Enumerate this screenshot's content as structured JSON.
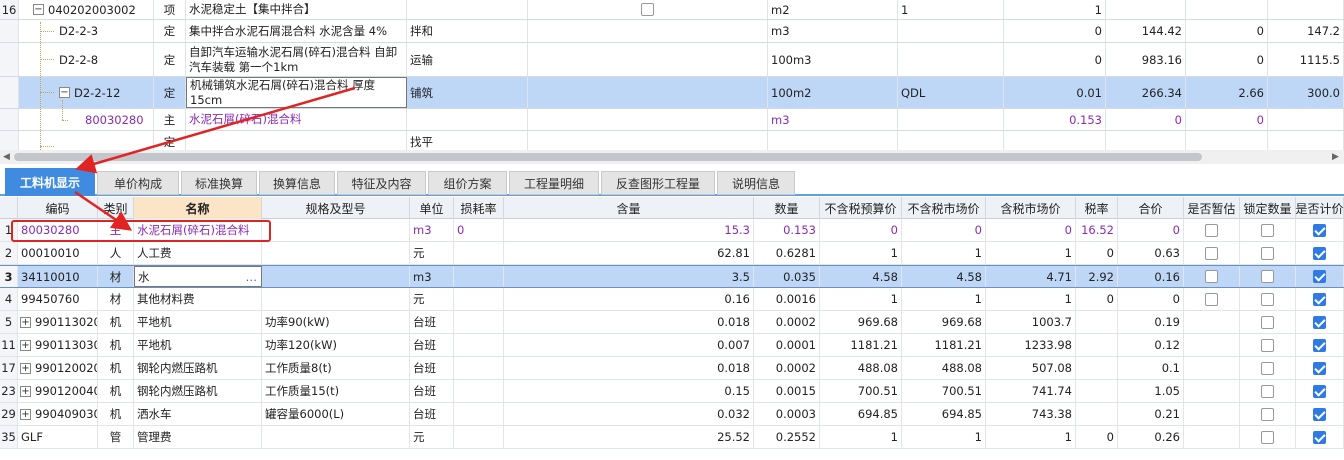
{
  "upper_rows": [
    {
      "rownum": "16",
      "code": "040202003002",
      "type": "项",
      "name": "水泥稳定土【集中拌合】",
      "spec": "",
      "unit": "m2",
      "c9": "1",
      "c10": "1",
      "c11": "",
      "c12": "",
      "c13": "",
      "c14": "",
      "expand": "−",
      "checkbox": true,
      "level": 0
    },
    {
      "rownum": "",
      "code": "D2-2-3",
      "type": "定",
      "name": "集中拌合水泥石屑混合料 水泥含量 4%",
      "spec": "拌和",
      "unit": "m3",
      "c9": "",
      "c10": "0",
      "c11": "144.42",
      "c12": "0",
      "c13": "147.2",
      "c14": "",
      "level": 1
    },
    {
      "rownum": "",
      "code": "D2-2-8",
      "type": "定",
      "name": "自卸汽车运输水泥石屑(碎石)混合料 自卸汽车装载 第一个1km",
      "spec": "运输",
      "unit": "100m3",
      "c9": "",
      "c10": "0",
      "c11": "983.16",
      "c12": "0",
      "c13": "1115.5",
      "c14": "",
      "level": 1
    },
    {
      "rownum": "",
      "code": "D2-2-12",
      "type": "定",
      "name": "机械铺筑水泥石屑(碎石)混合料 厚度 15cm",
      "spec": "铺筑",
      "unit": "100m2",
      "c9": "QDL",
      "c10": "0.01",
      "c11": "266.34",
      "c12": "2.66",
      "c13": "300.0",
      "c14": "",
      "expand": "−",
      "level": 1,
      "selected": true
    },
    {
      "rownum": "",
      "code": "80030280",
      "type": "主",
      "name": "水泥石屑(碎石)混合料",
      "spec": "",
      "unit": "m3",
      "c9": "",
      "c10": "0.153",
      "c11": "0",
      "c12": "0",
      "c13": "",
      "c14": "",
      "level": 2,
      "purple": true
    },
    {
      "rownum": "",
      "code": "",
      "type": "定",
      "name": "",
      "spec": "找平",
      "unit": "",
      "c9": "",
      "c10": "",
      "c11": "",
      "c12": "",
      "c13": "",
      "c14": "",
      "level": 1
    }
  ],
  "tabs": [
    "工料机显示",
    "单价构成",
    "标准换算",
    "换算信息",
    "特征及内容",
    "组价方案",
    "工程量明细",
    "反查图形工程量",
    "说明信息"
  ],
  "headers": [
    "编码",
    "类别",
    "名称",
    "规格及型号",
    "单位",
    "损耗率",
    "含量",
    "数量",
    "不含税预算价",
    "不含税市场价",
    "含税市场价",
    "税率",
    "合价",
    "是否暂估",
    "锁定数量",
    "是否计价"
  ],
  "rows": [
    {
      "rownum": "1",
      "code": "80030280",
      "cat": "主",
      "name": "水泥石屑(碎石)混合料",
      "spec": "",
      "unit": "m3",
      "loss": "0",
      "content": "15.3",
      "qty": "0.153",
      "p1": "0",
      "p2": "0",
      "p3": "0",
      "tax": "16.52",
      "total": "0",
      "est": false,
      "lock": false,
      "calc": true,
      "purple": true
    },
    {
      "rownum": "2",
      "code": "00010010",
      "cat": "人",
      "name": "人工费",
      "spec": "",
      "unit": "元",
      "loss": "",
      "content": "62.81",
      "qty": "0.6281",
      "p1": "1",
      "p2": "1",
      "p3": "1",
      "tax": "0",
      "total": "0.63",
      "est": false,
      "lock": false,
      "calc": true
    },
    {
      "rownum": "3",
      "code": "34110010",
      "cat": "材",
      "name": "水",
      "spec": "",
      "unit": "m3",
      "loss": "",
      "content": "3.5",
      "qty": "0.035",
      "p1": "4.58",
      "p2": "4.58",
      "p3": "4.71",
      "tax": "2.92",
      "total": "0.16",
      "est": false,
      "lock": false,
      "calc": true,
      "selected": true
    },
    {
      "rownum": "4",
      "code": "99450760",
      "cat": "材",
      "name": "其他材料费",
      "spec": "",
      "unit": "元",
      "loss": "",
      "content": "0.16",
      "qty": "0.0016",
      "p1": "1",
      "p2": "1",
      "p3": "1",
      "tax": "0",
      "total": "0",
      "est": false,
      "lock": false,
      "calc": true
    },
    {
      "rownum": "5",
      "code": "990113020",
      "cat": "机",
      "name": "平地机",
      "spec": "功率90(kW)",
      "unit": "台班",
      "loss": "",
      "content": "0.018",
      "qty": "0.0002",
      "p1": "969.68",
      "p2": "969.68",
      "p3": "1003.7",
      "tax": "",
      "total": "0.19",
      "lock": false,
      "calc": true,
      "expand": "+"
    },
    {
      "rownum": "11",
      "code": "990113030",
      "cat": "机",
      "name": "平地机",
      "spec": "功率120(kW)",
      "unit": "台班",
      "loss": "",
      "content": "0.007",
      "qty": "0.0001",
      "p1": "1181.21",
      "p2": "1181.21",
      "p3": "1233.98",
      "tax": "",
      "total": "0.12",
      "lock": false,
      "calc": true,
      "expand": "+"
    },
    {
      "rownum": "17",
      "code": "990120020",
      "cat": "机",
      "name": "钢轮内燃压路机",
      "spec": "工作质量8(t)",
      "unit": "台班",
      "loss": "",
      "content": "0.018",
      "qty": "0.0002",
      "p1": "488.08",
      "p2": "488.08",
      "p3": "507.08",
      "tax": "",
      "total": "0.1",
      "lock": false,
      "calc": true,
      "expand": "+"
    },
    {
      "rownum": "23",
      "code": "990120040",
      "cat": "机",
      "name": "钢轮内燃压路机",
      "spec": "工作质量15(t)",
      "unit": "台班",
      "loss": "",
      "content": "0.15",
      "qty": "0.0015",
      "p1": "700.51",
      "p2": "700.51",
      "p3": "741.74",
      "tax": "",
      "total": "1.05",
      "lock": false,
      "calc": true,
      "expand": "+"
    },
    {
      "rownum": "29",
      "code": "990409030",
      "cat": "机",
      "name": "洒水车",
      "spec": "罐容量6000(L)",
      "unit": "台班",
      "loss": "",
      "content": "0.032",
      "qty": "0.0003",
      "p1": "694.85",
      "p2": "694.85",
      "p3": "743.38",
      "tax": "",
      "total": "0.21",
      "lock": false,
      "calc": true,
      "expand": "+"
    },
    {
      "rownum": "35",
      "code": "GLF",
      "cat": "管",
      "name": "管理费",
      "spec": "",
      "unit": "元",
      "loss": "",
      "content": "25.52",
      "qty": "0.2552",
      "p1": "1",
      "p2": "1",
      "p3": "1",
      "tax": "0",
      "total": "0.26",
      "lock": false,
      "calc": true
    }
  ],
  "dots": "…",
  "colors": {
    "accent": "#3f8be0",
    "selected_row": "#bfd7f7",
    "highlight": "#e02424",
    "purple": "#8a2bb5"
  }
}
